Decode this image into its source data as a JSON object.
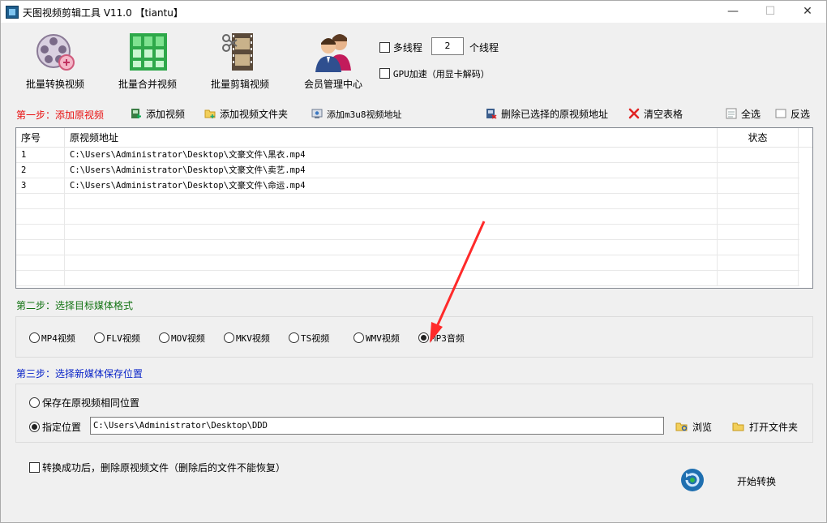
{
  "window": {
    "title": "天图视频剪辑工具 V11.0  【tiantu】",
    "minimize": "—",
    "maximize": "☐",
    "close": "✕"
  },
  "toolbar": {
    "batch_convert": "批量转换视频",
    "batch_merge": "批量合并视频",
    "batch_cut": "批量剪辑视频",
    "member_center": "会员管理中心"
  },
  "options": {
    "multithread_label": "多线程",
    "thread_count": "2",
    "thread_unit": "个线程",
    "gpu_label": "GPU加速（用显卡解码）"
  },
  "step1": {
    "title": "第一步：添加原视频",
    "add_video": "添加视频",
    "add_folder": "添加视频文件夹",
    "add_m3u8": "添加m3u8视频地址",
    "delete_selected": "删除已选择的原视频地址",
    "clear_table": "清空表格",
    "select_all": "全选",
    "invert": "反选"
  },
  "table": {
    "headers": {
      "index": "序号",
      "path": "原视频地址",
      "status": "状态"
    },
    "rows": [
      {
        "index": "1",
        "path": "C:\\Users\\Administrator\\Desktop\\文豪文件\\黑衣.mp4",
        "status": ""
      },
      {
        "index": "2",
        "path": "C:\\Users\\Administrator\\Desktop\\文豪文件\\卖艺.mp4",
        "status": ""
      },
      {
        "index": "3",
        "path": "C:\\Users\\Administrator\\Desktop\\文豪文件\\命运.mp4",
        "status": ""
      }
    ]
  },
  "step2": {
    "title": "第二步：选择目标媒体格式",
    "formats": [
      "MP4视频",
      "FLV视频",
      "MOV视频",
      "MKV视频",
      "TS视频",
      "WMV视频",
      "MP3音频"
    ],
    "selected": "MP3音频"
  },
  "step3": {
    "title": "第三步：选择新媒体保存位置",
    "same_location": "保存在原视频相同位置",
    "custom_location": "指定位置",
    "path": "C:\\Users\\Administrator\\Desktop\\DDD",
    "browse": "浏览",
    "open_folder": "打开文件夹"
  },
  "footer": {
    "delete_after": "转换成功后，删除原视频文件（删除后的文件不能恢复）",
    "start": "开始转换"
  },
  "colors": {
    "step1": "#e81010",
    "step2": "#137313",
    "step3": "#0a24c8",
    "annotation_arrow": "#ff2a2a"
  }
}
